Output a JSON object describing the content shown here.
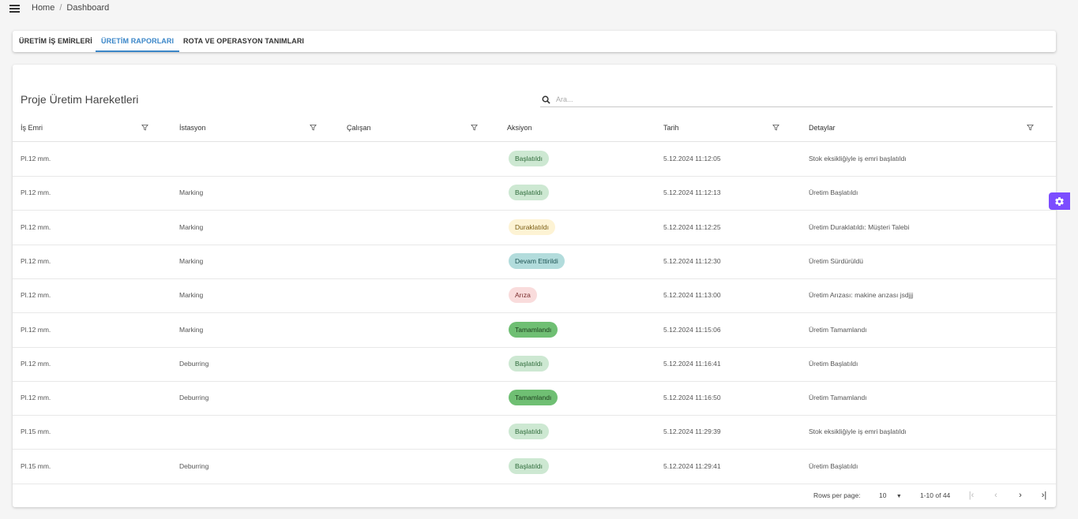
{
  "breadcrumb": {
    "home": "Home",
    "separator": "/",
    "current": "Dashboard"
  },
  "tabs": [
    {
      "label": "ÜRETİM İŞ EMİRLERİ",
      "active": false
    },
    {
      "label": "ÜRETİM RAPORLARI",
      "active": true
    },
    {
      "label": "ROTA VE OPERASYON TANIMLARI",
      "active": false
    }
  ],
  "page_title": "Proje Üretim Hareketleri",
  "search": {
    "placeholder": "Ara...",
    "value": ""
  },
  "columns": [
    {
      "label": "İş Emri",
      "filter": true
    },
    {
      "label": "İstasyon",
      "filter": true
    },
    {
      "label": "Çalışan",
      "filter": true
    },
    {
      "label": "Aksiyon",
      "filter": false
    },
    {
      "label": "Tarih",
      "filter": true
    },
    {
      "label": "Detaylar",
      "filter": true
    }
  ],
  "status_colors": {
    "started": {
      "bg": "#cde8d2",
      "fg": "#2e6b3a"
    },
    "paused": {
      "bg": "#fdf3d4",
      "fg": "#7a5c12"
    },
    "continued": {
      "bg": "#b2dcdc",
      "fg": "#1e5454"
    },
    "fault": {
      "bg": "#f9dcdc",
      "fg": "#7a2d2d"
    },
    "completed": {
      "bg": "#6fbf73",
      "fg": "#1c3d1d"
    }
  },
  "rows": [
    {
      "is_emri": "Pl.12 mm.",
      "istasyon": "",
      "calisan": "",
      "aksiyon": "Başlatıldı",
      "status": "started",
      "tarih": "5.12.2024 11:12:05",
      "detaylar": "Stok eksikliğiyle iş emri başlatıldı"
    },
    {
      "is_emri": "Pl.12 mm.",
      "istasyon": "Marking",
      "calisan": "",
      "aksiyon": "Başlatıldı",
      "status": "started",
      "tarih": "5.12.2024 11:12:13",
      "detaylar": "Üretim Başlatıldı"
    },
    {
      "is_emri": "Pl.12 mm.",
      "istasyon": "Marking",
      "calisan": "",
      "aksiyon": "Duraklatıldı",
      "status": "paused",
      "tarih": "5.12.2024 11:12:25",
      "detaylar": "Üretim Duraklatıldı: Müşteri Talebi"
    },
    {
      "is_emri": "Pl.12 mm.",
      "istasyon": "Marking",
      "calisan": "",
      "aksiyon": "Devam Ettirildi",
      "status": "continued",
      "tarih": "5.12.2024 11:12:30",
      "detaylar": "Üretim Sürdürüldü"
    },
    {
      "is_emri": "Pl.12 mm.",
      "istasyon": "Marking",
      "calisan": "",
      "aksiyon": "Arıza",
      "status": "fault",
      "tarih": "5.12.2024 11:13:00",
      "detaylar": "Üretim Arızası: makine arızası jsdjjj"
    },
    {
      "is_emri": "Pl.12 mm.",
      "istasyon": "Marking",
      "calisan": "",
      "aksiyon": "Tamamlandı",
      "status": "completed",
      "tarih": "5.12.2024 11:15:06",
      "detaylar": "Üretim Tamamlandı"
    },
    {
      "is_emri": "Pl.12 mm.",
      "istasyon": "Deburring",
      "calisan": "",
      "aksiyon": "Başlatıldı",
      "status": "started",
      "tarih": "5.12.2024 11:16:41",
      "detaylar": "Üretim Başlatıldı"
    },
    {
      "is_emri": "Pl.12 mm.",
      "istasyon": "Deburring",
      "calisan": "",
      "aksiyon": "Tamamlandı",
      "status": "completed",
      "tarih": "5.12.2024 11:16:50",
      "detaylar": "Üretim Tamamlandı"
    },
    {
      "is_emri": "Pl.15 mm.",
      "istasyon": "",
      "calisan": "",
      "aksiyon": "Başlatıldı",
      "status": "started",
      "tarih": "5.12.2024 11:29:39",
      "detaylar": "Stok eksikliğiyle iş emri başlatıldı"
    },
    {
      "is_emri": "Pl.15 mm.",
      "istasyon": "Deburring",
      "calisan": "",
      "aksiyon": "Başlatıldı",
      "status": "started",
      "tarih": "5.12.2024 11:29:41",
      "detaylar": "Üretim Başlatıldı"
    }
  ],
  "pagination": {
    "rows_per_page_label": "Rows per page:",
    "rows_per_page": "10",
    "range": "1-10 of 44"
  },
  "accent_color": "#3a86c8",
  "settings_button_color": "#7c4dff"
}
